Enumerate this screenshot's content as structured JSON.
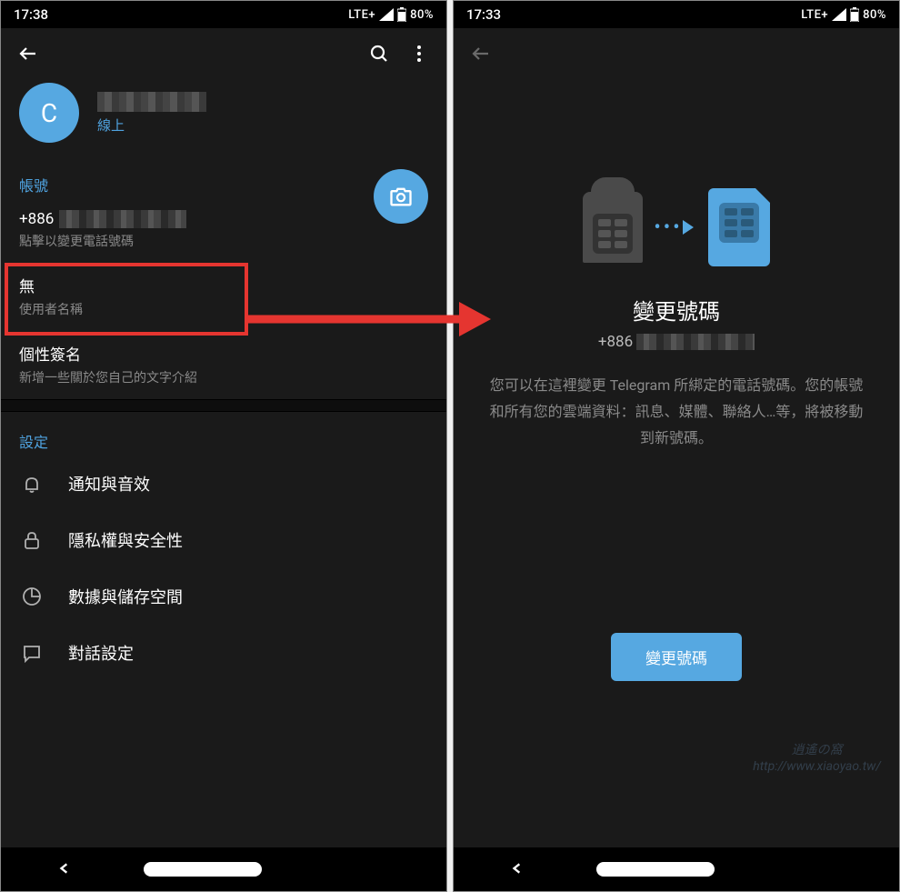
{
  "left": {
    "status": {
      "time": "17:38",
      "network": "LTE+",
      "battery": "80%"
    },
    "profile": {
      "avatar_letter": "C",
      "online_status": "線上"
    },
    "account": {
      "section_title": "帳號",
      "phone_prefix": "+886",
      "phone_hint": "點擊以變更電話號碼",
      "username_value": "無",
      "username_hint": "使用者名稱",
      "bio_title": "個性簽名",
      "bio_hint": "新增一些關於您自己的文字介紹"
    },
    "settings": {
      "section_title": "設定",
      "items": [
        {
          "label": "通知與音效",
          "icon": "bell"
        },
        {
          "label": "隱私權與安全性",
          "icon": "lock"
        },
        {
          "label": "數據與儲存空間",
          "icon": "pie"
        },
        {
          "label": "對話設定",
          "icon": "chat"
        }
      ]
    }
  },
  "right": {
    "status": {
      "time": "17:33",
      "network": "LTE+",
      "battery": "80%"
    },
    "title": "變更號碼",
    "phone_prefix": "+886",
    "description": "您可以在這裡變更 Telegram 所綁定的電話號碼。您的帳號和所有您的雲端資料：訊息、媒體、聯絡人…等，將被移動到新號碼。",
    "button": "變更號碼"
  },
  "watermark": "逍遙の窩\nhttp://www.xiaoyao.tw/"
}
